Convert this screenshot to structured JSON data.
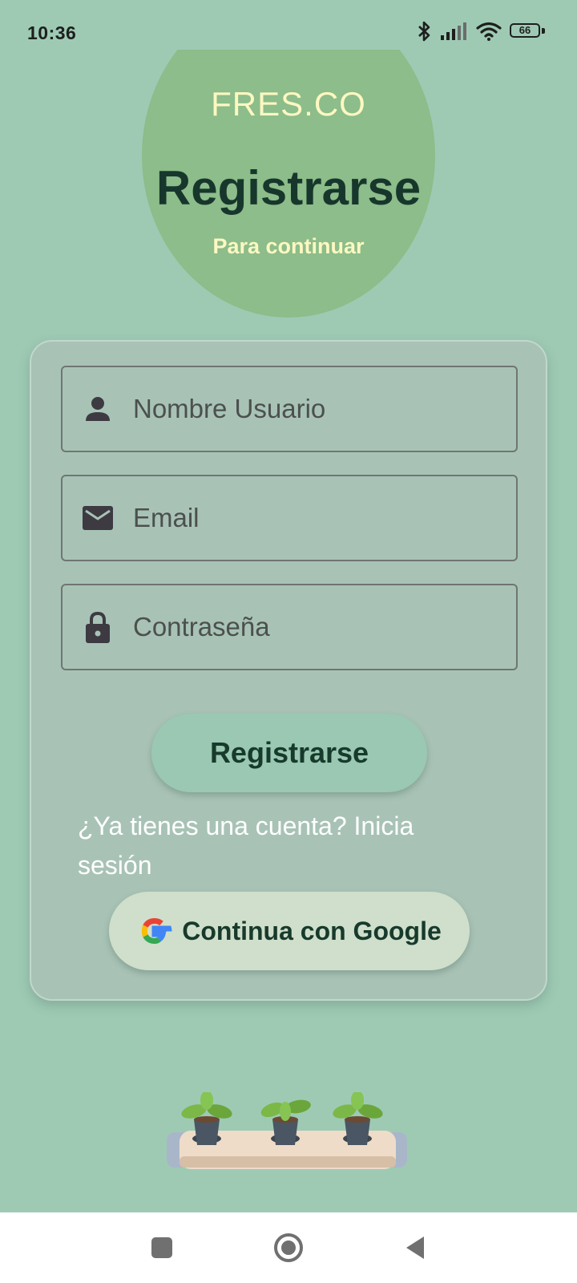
{
  "status_bar": {
    "time": "10:36",
    "battery": "66",
    "icons": [
      "bluetooth-icon",
      "signal-icon",
      "wifi-icon",
      "battery-icon"
    ]
  },
  "header": {
    "brand": "FRES.CO",
    "title": "Registrarse",
    "subtitle": "Para continuar"
  },
  "form": {
    "username_placeholder": "Nombre Usuario",
    "email_placeholder": "Email",
    "password_placeholder": "Contraseña",
    "register_button": "Registrarse",
    "login_prompt": "¿Ya tienes una cuenta? Inicia sesión",
    "google_button": "Continua con Google"
  },
  "nav_bar": {
    "buttons": [
      "recents-icon",
      "home-icon",
      "back-icon"
    ]
  },
  "colors": {
    "background": "#9ecab4",
    "hero_circle": "#8cbd8a",
    "title": "#17372c",
    "brand": "#fdf7c2",
    "card": "#a8c3b6",
    "primary_button": "#9ac8b2",
    "google_button": "#cfdfcb"
  }
}
